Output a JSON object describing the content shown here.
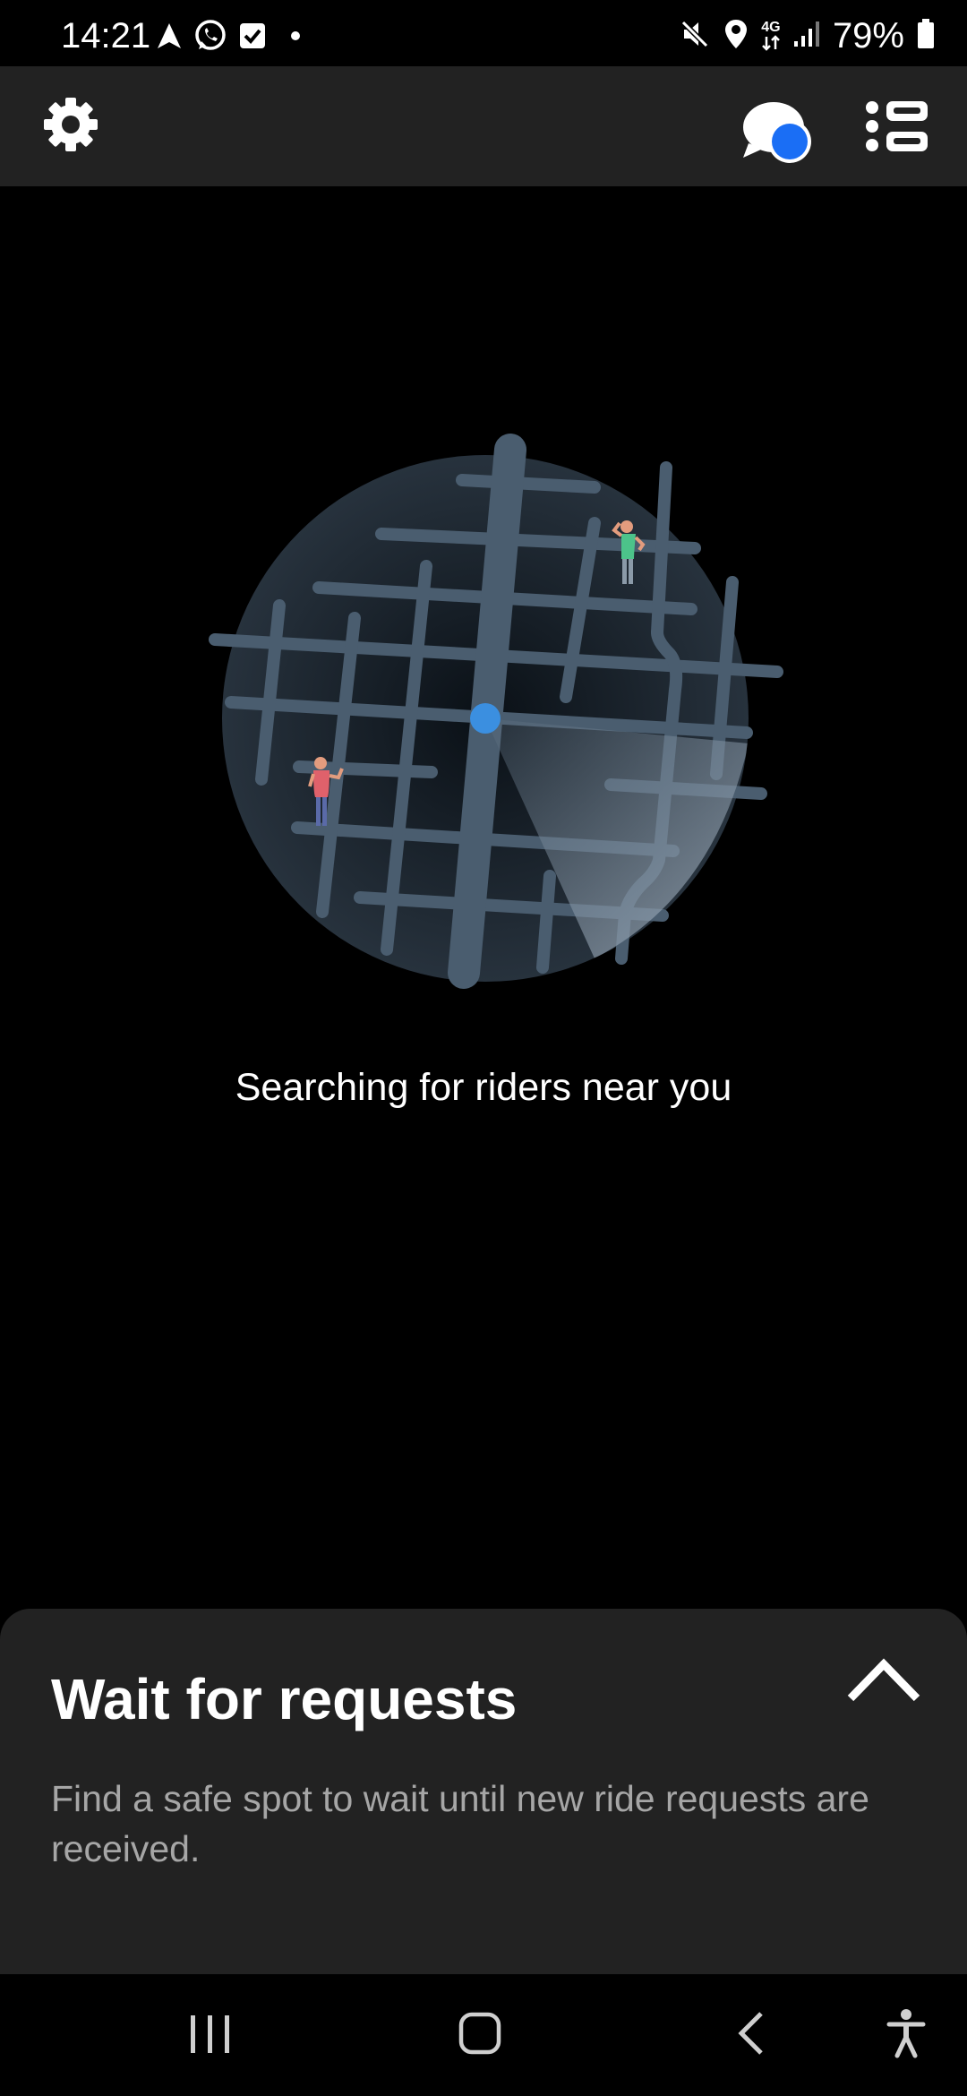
{
  "status_bar": {
    "time": "14:21",
    "left_icons": [
      "navigation-arrow-icon",
      "whatsapp-icon",
      "checkbox-notification-icon",
      "dot-icon"
    ],
    "network_label": "4G",
    "battery_percent": "79%",
    "right_icons": [
      "mute-icon",
      "location-icon",
      "network-4g-icon",
      "signal-icon",
      "battery-icon"
    ]
  },
  "app_bar": {
    "settings_icon": "gear-icon",
    "chat_icon": "chat-bubble-icon",
    "chat_badge_color": "#1a6ef5",
    "list_icon": "list-icon"
  },
  "illustration": {
    "accent_color": "#3b8fe0",
    "rider_colors": [
      "#4cc38a",
      "#e0616b"
    ]
  },
  "main": {
    "searching_text": "Searching for riders near you"
  },
  "sheet": {
    "title": "Wait for requests",
    "description": "Find a safe spot to wait until new ride requests are received.",
    "toggle_icon": "chevron-up-icon"
  },
  "nav_bar": {
    "buttons": [
      "recent-apps-icon",
      "home-icon",
      "back-icon",
      "accessibility-icon"
    ]
  }
}
